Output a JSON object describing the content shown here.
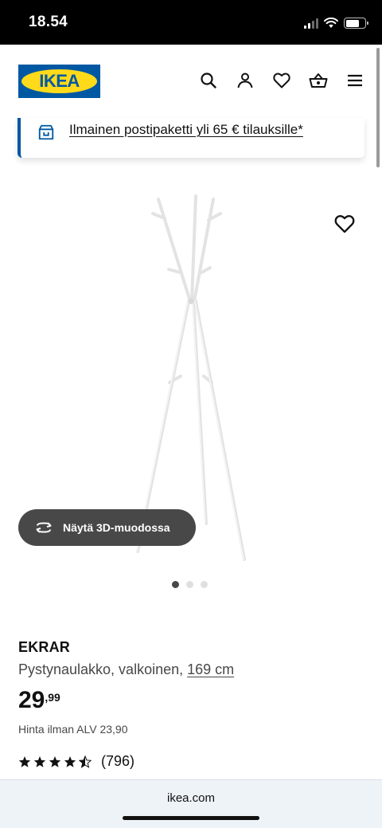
{
  "status_bar": {
    "time": "18.54",
    "signal_icon": "cellular-signal-icon",
    "wifi_icon": "wifi-icon",
    "battery_icon": "battery-icon"
  },
  "header": {
    "logo_text": "IKEA",
    "brand_colors": {
      "blue": "#0058a3",
      "yellow": "#ffda1a"
    },
    "icons": [
      "search-icon",
      "user-icon",
      "heart-icon",
      "basket-icon",
      "menu-icon"
    ]
  },
  "banner": {
    "icon": "parcel-icon",
    "text": "Ilmainen postipaketti yli 65 € tilauksille*"
  },
  "gallery": {
    "show_3d_label": "Näytä 3D-muodossa",
    "page_count": 3,
    "active_page": 1
  },
  "product": {
    "name": "EKRAR",
    "description": "Pystynaulakko, valkoinen,",
    "size": "169 cm",
    "price_integer": "29",
    "price_decimal": ",99",
    "price_vat": "Hinta ilman ALV 23,90",
    "rating": 4.5,
    "rating_max": 5,
    "review_count": "(796)"
  },
  "browser": {
    "url": "ikea.com"
  }
}
